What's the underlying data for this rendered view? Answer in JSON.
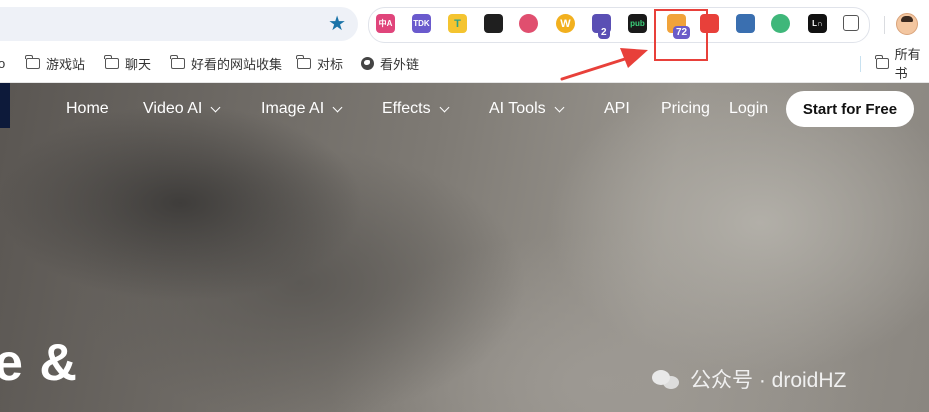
{
  "browser": {
    "toolbar": {
      "bookmark_star_icon": "star-filled-icon",
      "extensions": [
        {
          "name": "translate-extension-icon",
          "label": "中A",
          "bg": "#e0457b"
        },
        {
          "name": "tdk-extension-icon",
          "label": "TDK",
          "bg": "#6a5acd"
        },
        {
          "name": "t-extension-icon",
          "label": "T",
          "bg": "#f4c430"
        },
        {
          "name": "dark-square-extension-icon",
          "label": "",
          "bg": "#1f1f1f"
        },
        {
          "name": "colorful-circle-extension-icon",
          "label": "",
          "bg": "#e04f6f"
        },
        {
          "name": "w-extension-icon",
          "label": "W",
          "bg": "#f2b01e"
        },
        {
          "name": "graduate-cap-extension-icon",
          "label": "",
          "bg": "#5a4fb4",
          "badge": "2"
        },
        {
          "name": "pub-extension-icon",
          "label": "pub",
          "bg": "#1a1a1a"
        },
        {
          "name": "tabs-extension-icon",
          "label": "",
          "bg": "#f1a33a",
          "badge": "72"
        },
        {
          "name": "red-chat-extension-icon",
          "label": "",
          "bg": "#e8403a"
        },
        {
          "name": "robot-extension-icon",
          "label": "",
          "bg": "#3a6fb0"
        },
        {
          "name": "green-circle-extension-icon",
          "label": "",
          "bg": "#3fb77a"
        },
        {
          "name": "ln-extension-icon",
          "label": "L∩",
          "bg": "#111111"
        },
        {
          "name": "puzzle-extensions-icon",
          "label": "",
          "bg": "#ffffff"
        }
      ],
      "profile_avatar": "profile-avatar"
    },
    "bookmarks": [
      {
        "label": "o",
        "icon": "none"
      },
      {
        "label": "游戏站",
        "icon": "folder-icon"
      },
      {
        "label": "聊天",
        "icon": "folder-icon"
      },
      {
        "label": "好看的网站收集",
        "icon": "folder-icon"
      },
      {
        "label": "对标",
        "icon": "folder-icon"
      },
      {
        "label": "看外链",
        "icon": "globe-icon"
      },
      {
        "label": "所有书",
        "icon": "folder-icon"
      }
    ]
  },
  "site": {
    "nav": [
      {
        "label": "Home",
        "dropdown": false
      },
      {
        "label": "Video AI",
        "dropdown": true
      },
      {
        "label": "Image AI",
        "dropdown": true
      },
      {
        "label": "Effects",
        "dropdown": true
      },
      {
        "label": "AI Tools",
        "dropdown": true
      },
      {
        "label": "API",
        "dropdown": false
      },
      {
        "label": "Pricing",
        "dropdown": false
      },
      {
        "label": "Login",
        "dropdown": false
      }
    ],
    "cta": "Start for Free",
    "headline": "e &"
  },
  "watermark": {
    "text": "公众号 · droidHZ",
    "icon": "wechat-icon"
  },
  "annotation": {
    "color": "#e8403a",
    "target": "tabs-extension-icon"
  }
}
